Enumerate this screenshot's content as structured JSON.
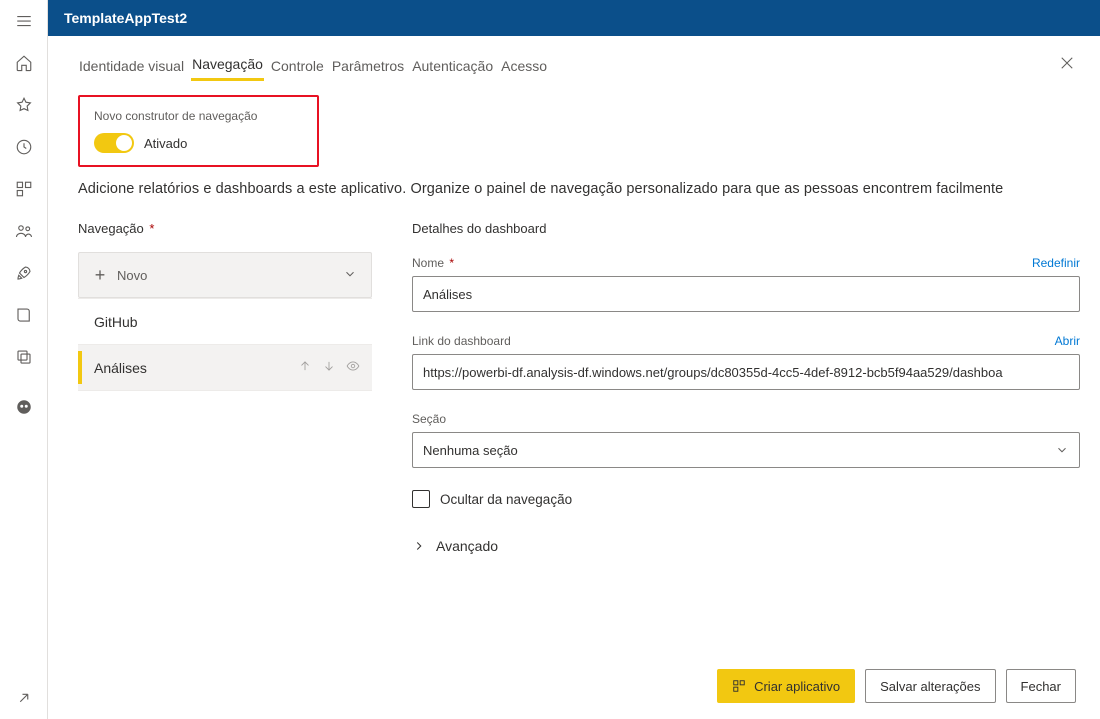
{
  "rail": {
    "icons": [
      "menu",
      "home",
      "star",
      "recent",
      "app",
      "people",
      "rocket",
      "book",
      "copy",
      "owl"
    ]
  },
  "header": {
    "title": "TemplateAppTest2"
  },
  "tabs": {
    "items": [
      "Identidade visual",
      "Navegação",
      "Controle",
      "Parâmetros",
      "Autenticação",
      "Acesso"
    ],
    "selected_index": 1
  },
  "builder": {
    "label": "Novo construtor de navegação",
    "state": "Ativado"
  },
  "description": "Adicione relatórios e dashboards a este aplicativo. Organize o painel de navegação personalizado para que as pessoas encontrem facilmente",
  "navcol": {
    "title": "Navegação",
    "new_label": "Novo",
    "items": [
      {
        "label": "GitHub",
        "selected": false
      },
      {
        "label": "Análises",
        "selected": true
      }
    ]
  },
  "details": {
    "title": "Detalhes do dashboard",
    "name_label": "Nome",
    "reset": "Redefinir",
    "name_value": "Análises",
    "link_label": "Link do dashboard",
    "open": "Abrir",
    "link_value": "https://powerbi-df.analysis-df.windows.net/groups/dc80355d-4cc5-4def-8912-bcb5f94aa529/dashboa",
    "section_label": "Seção",
    "section_value": "Nenhuma seção",
    "hide_label": "Ocultar da navegação",
    "advanced": "Avançado"
  },
  "footer": {
    "create": "Criar aplicativo",
    "save": "Salvar alterações",
    "close": "Fechar"
  }
}
